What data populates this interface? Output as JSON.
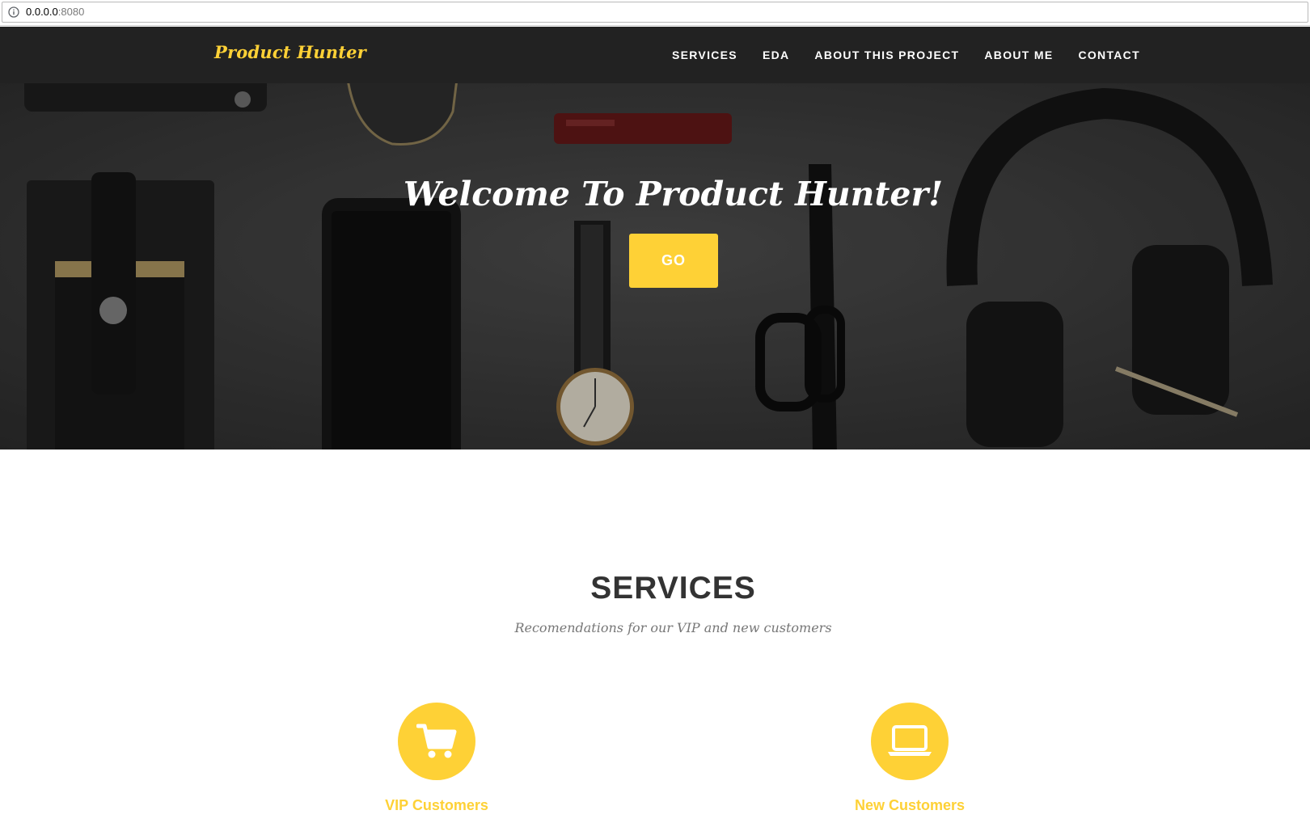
{
  "browser": {
    "url_host": "0.0.0.0",
    "url_port": ":8080",
    "icons": {
      "info": "info-icon"
    }
  },
  "navbar": {
    "brand": "Product Hunter",
    "links": [
      "SERVICES",
      "EDA",
      "ABOUT THIS PROJECT",
      "ABOUT ME",
      "CONTACT"
    ]
  },
  "hero": {
    "title": "Welcome To Product Hunter!",
    "button_label": "GO"
  },
  "services": {
    "title": "SERVICES",
    "subtitle": "Recomendations for our VIP and new customers",
    "items": [
      {
        "label": "VIP Customers",
        "icon": "shopping-cart-icon"
      },
      {
        "label": "New Customers",
        "icon": "laptop-icon"
      }
    ]
  },
  "colors": {
    "accent": "#fed136",
    "navbar_bg": "#222222",
    "heading": "#333333",
    "muted": "#777777"
  }
}
